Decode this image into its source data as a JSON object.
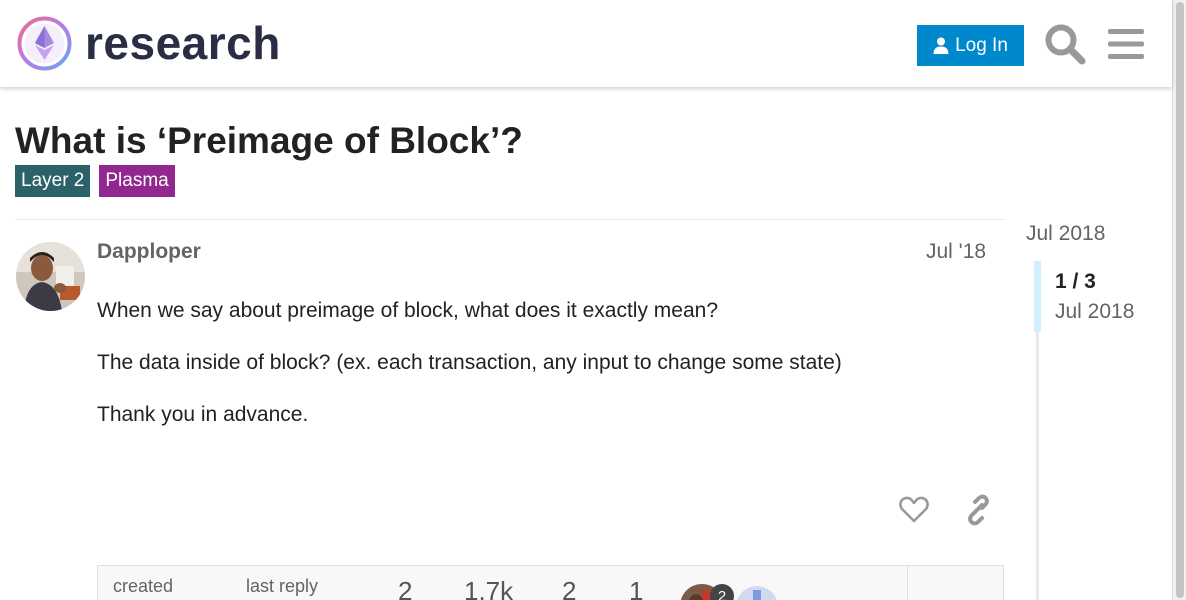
{
  "header": {
    "logo_text": "research",
    "login_label": "Log In"
  },
  "topic": {
    "title": "What is ‘Preimage of Block’?",
    "tags": [
      {
        "label": "Layer 2",
        "color": "#2b6269"
      },
      {
        "label": "Plasma",
        "color": "#92278f"
      }
    ]
  },
  "post": {
    "username": "Dapploper",
    "date": "Jul '18",
    "paragraphs": [
      "When we say about preimage of block, what does it exactly mean?",
      "The data inside of block? (ex. each transaction, any input to change some state)",
      "Thank you in advance."
    ]
  },
  "topic_map": {
    "created_label": "created",
    "last_reply_label": "last reply",
    "replies": "2",
    "views": "1.7k",
    "users": "2",
    "likes": "1",
    "poster_badge": "2"
  },
  "timeline": {
    "top_date": "Jul 2018",
    "position": "1 / 3",
    "current_date": "Jul 2018"
  },
  "colors": {
    "accent": "#0088cc",
    "tag_layer2": "#2b6269",
    "tag_plasma": "#92278f"
  },
  "icons": [
    "logo-mark-icon",
    "user-icon",
    "search-icon",
    "hamburger-icon",
    "heart-icon",
    "link-icon"
  ]
}
